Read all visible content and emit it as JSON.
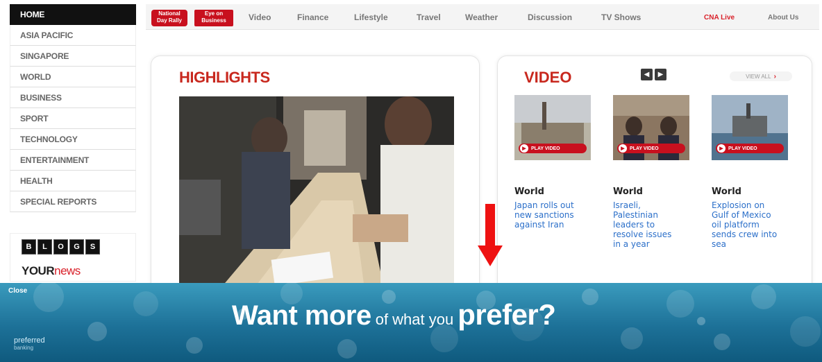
{
  "left_nav": {
    "items": [
      "HOME",
      "ASIA PACIFIC",
      "SINGAPORE",
      "WORLD",
      "BUSINESS",
      "SPORT",
      "TECHNOLOGY",
      "ENTERTAINMENT",
      "HEALTH",
      "SPECIAL REPORTS"
    ],
    "blogs_letters": [
      "B",
      "L",
      "O",
      "G",
      "S"
    ],
    "yournews": {
      "your": "YOUR",
      "news": "news"
    }
  },
  "top_nav": {
    "badge1": {
      "line1": "National",
      "line2": "Day Rally"
    },
    "badge2": {
      "line1": "Eye on",
      "line2": "Business"
    },
    "links": [
      "Video",
      "Finance",
      "Lifestyle",
      "Travel",
      "Weather",
      "Discussion",
      "TV Shows"
    ],
    "cna_live": "CNA Live",
    "about": "About Us"
  },
  "highlights": {
    "title": "HIGHLIGHTS"
  },
  "video": {
    "title": "VIDEO",
    "view_all": "VIEW ALL",
    "play_label": "PLAY VIDEO",
    "items": [
      {
        "category": "World",
        "title": "Japan rolls out new sanctions against Iran"
      },
      {
        "category": "World",
        "title": "Israeli, Palestinian leaders to resolve issues in a year"
      },
      {
        "category": "World",
        "title": "Explosion on Gulf of Mexico oil platform sends crew into sea"
      }
    ]
  },
  "banner": {
    "close": "Close",
    "want_more": "Want more",
    "of_what_you": "of what you",
    "prefer": "prefer?",
    "logo_line1": "preferred",
    "logo_line2": "banking"
  },
  "colors": {
    "brand_red": "#c8281e",
    "link_blue": "#2b6fc9",
    "banner_blue": "#1d7198"
  }
}
